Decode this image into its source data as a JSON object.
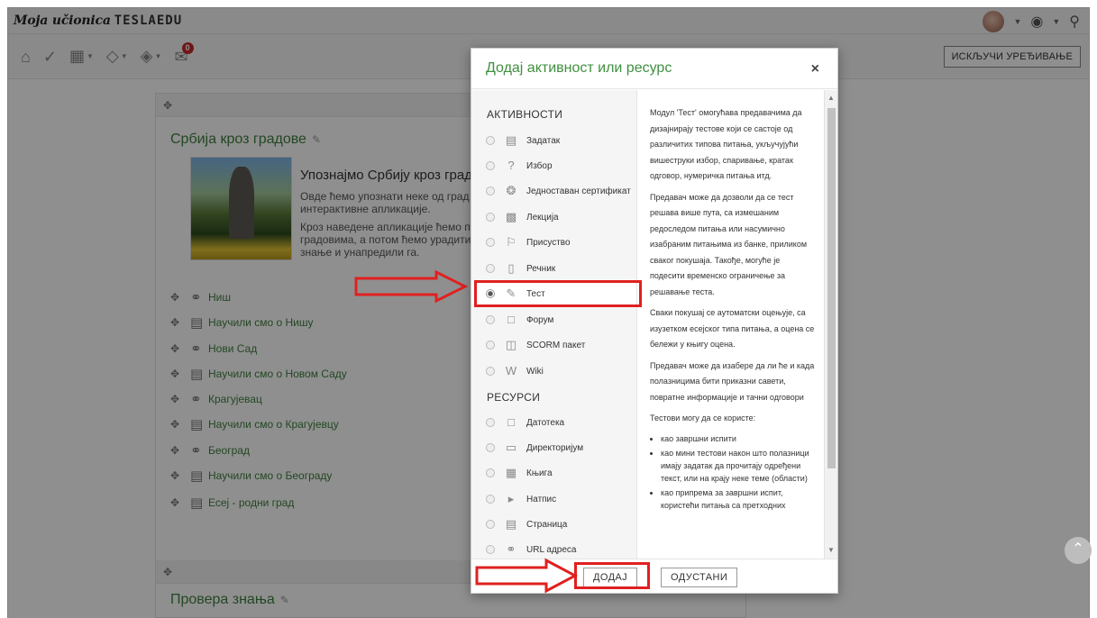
{
  "navbar": {
    "brand_script": "Moja učionica",
    "brand_logo": "TESLAEDU",
    "icons": [
      "avatar",
      "user-menu-caret",
      "help-icon",
      "search-icon"
    ]
  },
  "toolbar": {
    "icons": [
      "home-icon",
      "check-icon",
      "calendar-icon",
      "graduation-cap-icon",
      "graduation-cap-alt-icon",
      "mail-icon"
    ],
    "mail_badge": "0",
    "edit_button": "ИСКЉУЧИ УРЕЂИВАЊЕ"
  },
  "course": {
    "section1": {
      "title": "Србија кроз градове",
      "intro_heading": "Упознајмо Србију кроз град",
      "intro_lines": [
        "Овде ћемо упознати неке од град",
        "интерактивне апликације.",
        "Кроз наведене апликације ћемо п",
        "градовима, а потом ћемо урадити",
        "знање и унапредили га."
      ],
      "activities": [
        {
          "label": "Ниш",
          "icon": "url-link-icon"
        },
        {
          "label": "Научили смо о Нишу",
          "icon": "assignment-icon"
        },
        {
          "label": "Нови Сад",
          "icon": "url-link-icon"
        },
        {
          "label": "Научили смо о Новом Саду",
          "icon": "assignment-icon"
        },
        {
          "label": "Крагујевац",
          "icon": "url-link-icon"
        },
        {
          "label": "Научили смо о Крагујевцу",
          "icon": "assignment-icon"
        },
        {
          "label": "Београд",
          "icon": "url-link-icon"
        },
        {
          "label": "Научили смо о Београду",
          "icon": "assignment-icon"
        },
        {
          "label": "Есеј - родни град",
          "icon": "assignment-icon"
        }
      ]
    },
    "section2": {
      "title": "Провера знања"
    }
  },
  "modal": {
    "title": "Додај активност или ресурс",
    "close": "×",
    "activities_heading": "АКТИВНОСТИ",
    "resources_heading": "РЕСУРСИ",
    "activities": [
      {
        "label": "Задатак",
        "icon": "assignment-icon"
      },
      {
        "label": "Избор",
        "icon": "question-mark-icon"
      },
      {
        "label": "Једноставан сертификат",
        "icon": "certificate-icon"
      },
      {
        "label": "Лекција",
        "icon": "lesson-icon"
      },
      {
        "label": "Присуство",
        "icon": "flag-icon"
      },
      {
        "label": "Речник",
        "icon": "glossary-icon"
      },
      {
        "label": "Тест",
        "icon": "quiz-icon",
        "selected": true
      },
      {
        "label": "Форум",
        "icon": "forum-icon"
      },
      {
        "label": "SCORM пакет",
        "icon": "package-icon"
      },
      {
        "label": "Wiki",
        "icon": "wiki-icon"
      }
    ],
    "resources": [
      {
        "label": "Датотека",
        "icon": "file-icon"
      },
      {
        "label": "Директоријум",
        "icon": "folder-icon"
      },
      {
        "label": "Књига",
        "icon": "book-icon"
      },
      {
        "label": "Натпис",
        "icon": "label-icon"
      },
      {
        "label": "Страница",
        "icon": "page-icon"
      },
      {
        "label": "URL адреса",
        "icon": "url-link-icon"
      }
    ],
    "description": {
      "p1": "Модул 'Тест' омогућава предавачима да дизајнирају тестове који се састоје од различитих типова питања, укључујући вишеструки избор, спаривање, кратак одговор, нумеричка питања итд.",
      "p2": "Предавач може да дозволи да се тест решава више пута, са измешаним редоследом питања или насумично изабраним питањима из банке, приликом сваког покушаја. Такође, могуће је подесити временско ограничење за решавање теста.",
      "p3": "Сваки покушај се аутоматски оцењује, са изузетком есејског типа питања, а оцена се бележи у књигу оцена.",
      "p4": "Предавач може да изабере да ли ће и када полазницима бити приказни савети, повратне информације и тачни одговори",
      "p5": "Тестови могу да се користе:",
      "list": [
        "као завршни испити",
        "као мини тестови након што полазници имају задатак да прочитају одређени текст, или на крају неке теме (области)",
        "као припрема за завршни испит, користећи питања са претходних"
      ]
    },
    "add_button": "ДОДАЈ",
    "cancel_button": "ОДУСТАНИ"
  },
  "colors": {
    "accent_green": "#3f8f3f",
    "annotation_red": "#e02020",
    "overlay": "rgba(0,0,0,0.44)"
  }
}
